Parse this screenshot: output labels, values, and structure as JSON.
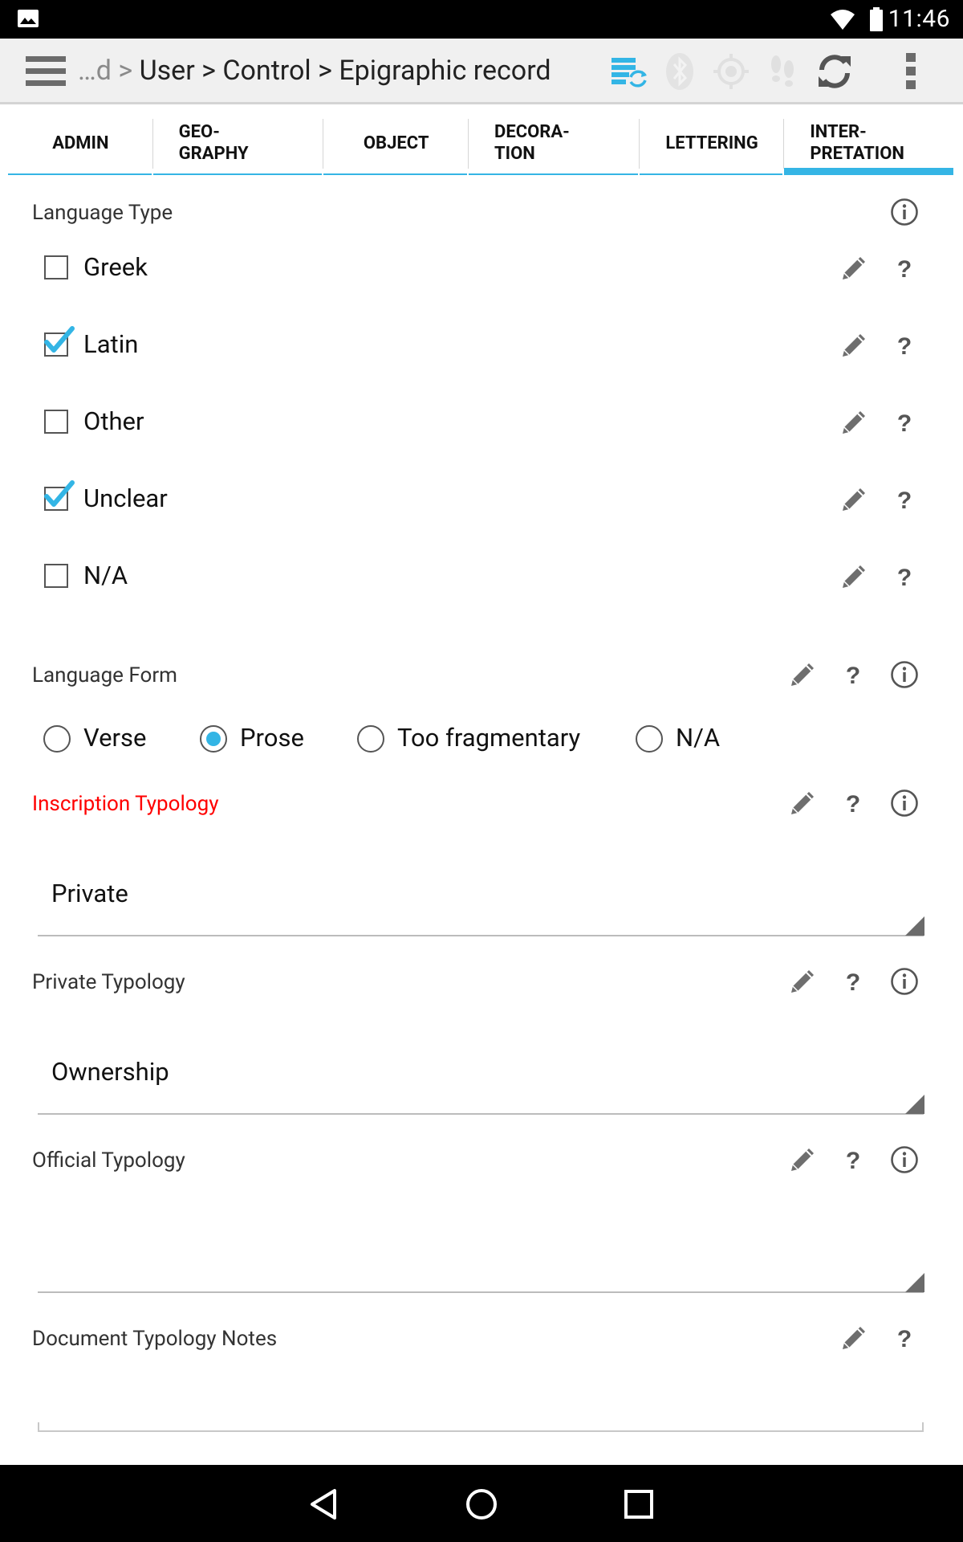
{
  "status": {
    "time": "11:46"
  },
  "breadcrumb": {
    "truncated": "…d",
    "sep1": " > ",
    "part1": "User",
    "sep2": " > ",
    "part2": "Control",
    "sep3": " > ",
    "part3": "Epigraphic record"
  },
  "tabs": [
    {
      "label": "ADMIN"
    },
    {
      "label": "GEO-\nGRAPHY"
    },
    {
      "label": "OBJECT"
    },
    {
      "label": "DECORA-\nTION"
    },
    {
      "label": "LETTERING"
    },
    {
      "label": "INTER-\nPRETATION"
    }
  ],
  "active_tab": "INTER-\nPRETATION",
  "accent_color": "#33b5e5",
  "required_color": "#ff0000",
  "language_type": {
    "label": "Language Type",
    "options": [
      {
        "label": "Greek",
        "checked": false
      },
      {
        "label": "Latin",
        "checked": true
      },
      {
        "label": "Other",
        "checked": false
      },
      {
        "label": "Unclear",
        "checked": true
      },
      {
        "label": "N/A",
        "checked": false
      }
    ]
  },
  "language_form": {
    "label": "Language Form",
    "options": [
      {
        "label": "Verse",
        "selected": false
      },
      {
        "label": "Prose",
        "selected": true
      },
      {
        "label": "Too fragmentary",
        "selected": false
      },
      {
        "label": "N/A",
        "selected": false
      }
    ]
  },
  "inscription_typology": {
    "label": "Inscription Typology",
    "value": "Private"
  },
  "private_typology": {
    "label": "Private Typology",
    "value": "Ownership"
  },
  "official_typology": {
    "label": "Official Typology",
    "value": ""
  },
  "document_typology_notes": {
    "label": "Document Typology Notes",
    "value": ""
  },
  "icons": {
    "menu": "hamburger-menu-icon",
    "sync_db": "database-sync-icon",
    "bluetooth": "bluetooth-icon",
    "gps": "gps-icon",
    "tracking": "footsteps-icon",
    "refresh": "refresh-icon",
    "overflow": "overflow-menu-icon",
    "edit": "pencil-icon",
    "help": "question-icon",
    "info": "info-icon"
  }
}
